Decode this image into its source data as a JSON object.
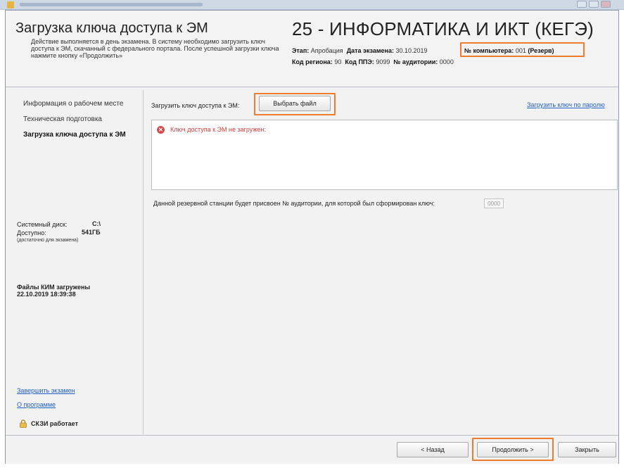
{
  "header": {
    "title": "Загрузка ключа доступа к ЭМ",
    "description": "Действие выполняется в день экзамена. В систему необходимо загрузить ключ доступа к ЭМ, скачанный с федерального портала. После успешной загрузки ключа нажмите кнопку «Продолжить»",
    "exam_title": "25 - ИНФОРМАТИКА И ИКТ (КЕГЭ)",
    "stage_label": "Этап:",
    "stage_value": "Апробация",
    "date_label": "Дата экзамена:",
    "date_value": "30.10.2019",
    "computer_label": "№ компьютера:",
    "computer_value": "001",
    "computer_role": "(Резерв)",
    "region_label": "Код региона:",
    "region_value": "90",
    "ppe_label": "Код ППЭ:",
    "ppe_value": "9099",
    "room_label": "№ аудитории:",
    "room_value": "0000"
  },
  "sidebar": {
    "items": [
      {
        "label": "Информация о рабочем месте"
      },
      {
        "label": "Техническая подготовка"
      },
      {
        "label": "Загрузка ключа доступа к ЭМ"
      }
    ],
    "disk_label": "Системный диск:",
    "disk_value": "C:\\",
    "free_label": "Доступно:",
    "free_value": "541ГБ",
    "free_note": "(достаточно для экзамена)",
    "files_status": "Файлы КИМ загружены",
    "files_datetime": "22.10.2019 18:39:38",
    "finish_link": "Завершить экзамен",
    "about_link": "О программе",
    "skzi_status": "СКЗИ работает"
  },
  "main": {
    "load_key_label": "Загрузить ключ доступа к ЭМ:",
    "choose_file_button": "Выбрать файл",
    "load_by_password_link": "Загрузить ключ по паролю",
    "error_message": "Ключ доступа к ЭМ не загружен:",
    "reserve_note": "Данной резервной станции будет присвоен № аудитории, для которой был сформирован ключ:",
    "room_number_field": "0000"
  },
  "footer": {
    "back_button": "< Назад",
    "continue_button": "Продолжить >",
    "close_button": "Закрыть"
  },
  "colors": {
    "highlight": "#ee7c2e",
    "error": "#d43a3a",
    "link": "#1f5fbf"
  }
}
